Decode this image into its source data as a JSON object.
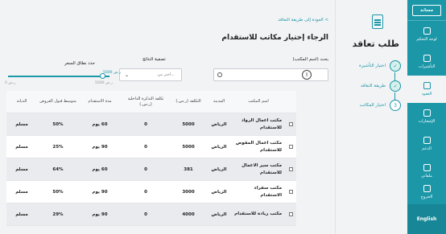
{
  "sidebar": {
    "logo": "مساند",
    "items": [
      {
        "label": "لوحة التحكم",
        "icon": "rocket-icon",
        "active": false
      },
      {
        "label": "التأشيرات",
        "icon": "passport-icon",
        "active": false
      },
      {
        "label": "العقود",
        "icon": "contract-icon",
        "active": true
      },
      {
        "label": "الإشعارات",
        "icon": "bell-icon",
        "active": false
      },
      {
        "label": "الدعم",
        "icon": "support-icon",
        "active": false
      },
      {
        "label": "ملفاتي",
        "icon": "gear-icon",
        "active": false
      }
    ],
    "logout": "الخروج",
    "language": "English"
  },
  "steps": {
    "title": "طلب تعاقد",
    "items": [
      {
        "label": "اختيار التأشيرة",
        "state": "done",
        "marker": "✓"
      },
      {
        "label": "طريقة التعاقد",
        "state": "done",
        "marker": "✓"
      },
      {
        "label": "اختيار المكاتب",
        "state": "current",
        "marker": "3"
      }
    ]
  },
  "header": {
    "back_link": "العودة إلى طريقة التعاقد  <",
    "title": "الرجاء إختيار مكاتب للاستقدام"
  },
  "search": {
    "label": "بحث (اسم المكتب)",
    "value": "",
    "placeholder": ""
  },
  "filter": {
    "label": "تصفية النتائج",
    "selected": "اختر من..."
  },
  "price_range": {
    "label": "حدد نطاق السعر",
    "max_value": "5000 ر.س",
    "min_label": "0 ر.س",
    "max_label": "5000 ر.س",
    "fill_fraction": 1.0
  },
  "table": {
    "headers": {
      "name": "اسم المكتب",
      "city": "المدينة",
      "cost": "التكلفة (ر.س.)",
      "internal": "تكلفة التذكرة الداخلية (ر.س.)",
      "duration": "مدة الاستقدام",
      "acceptance": "متوسط قبول العروض",
      "religion": "الديانة"
    },
    "rows": [
      {
        "name": "مكتب اعمال الرواد للاستقدام",
        "city": "الرياض",
        "cost": "5000",
        "internal": "0",
        "duration": "60 يوم",
        "acceptance": "50%",
        "religion": "مسلم"
      },
      {
        "name": "مكتب اعمال المفوض للاستقدام",
        "city": "الرياض",
        "cost": "5000",
        "internal": "0",
        "duration": "90 يوم",
        "acceptance": "25%",
        "religion": "مسلم"
      },
      {
        "name": "مكتب سير الاعمال للاستقدام",
        "city": "الرياض",
        "cost": "381",
        "internal": "0",
        "duration": "60 يوم",
        "acceptance": "64%",
        "religion": "مسلم"
      },
      {
        "name": "مكتب سفراء الاستقدام",
        "city": "الرياض",
        "cost": "3000",
        "internal": "0",
        "duration": "90 يوم",
        "acceptance": "50%",
        "religion": "مسلم"
      },
      {
        "name": "مكتب ريادة للاستقدام",
        "city": "الرياض",
        "cost": "4000",
        "internal": "0",
        "duration": "90 يوم",
        "acceptance": "29%",
        "religion": "مسلم"
      }
    ]
  },
  "colors": {
    "accent": "#1b97a8",
    "background": "#f2f3f5"
  }
}
